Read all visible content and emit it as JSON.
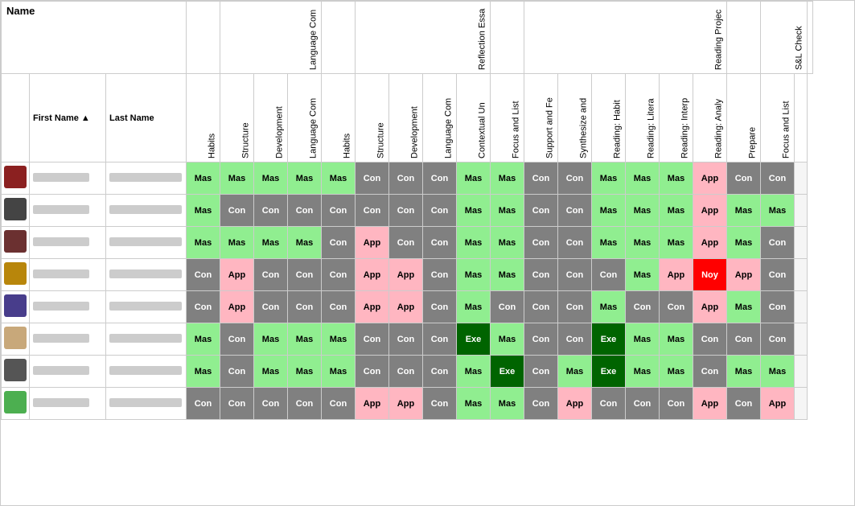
{
  "table": {
    "topHeaders": [
      {
        "label": "Name",
        "colspan": 3
      },
      {
        "label": "",
        "colspan": 1
      },
      {
        "label": "Language Com",
        "colspan": 3
      },
      {
        "label": "",
        "colspan": 1
      },
      {
        "label": "Reflection Essa",
        "colspan": 4
      },
      {
        "label": "",
        "colspan": 1
      },
      {
        "label": "Reading Projec",
        "colspan": 6
      },
      {
        "label": "",
        "colspan": 1
      },
      {
        "label": "S&L Check",
        "colspan": 3
      }
    ],
    "subHeaders": [
      "Habits",
      "Structure",
      "Development",
      "Language Com",
      "Habits",
      "Structure",
      "Development",
      "Language Com",
      "Contextual Un",
      "Focus and List",
      "Support and Fe",
      "Synthesize and",
      "Reading: Habit",
      "Reading: Litera",
      "Reading: Interp",
      "Reading: Analy",
      "Prepare",
      "Focus and List"
    ],
    "nameHeaders": [
      "First Name ▲",
      "Last Name"
    ],
    "avatarColors": [
      "#8B2020",
      "#444",
      "#6B3030",
      "#B8860B",
      "#483D8B",
      "#C8A87A",
      "#555",
      "#4CAF50"
    ],
    "rows": [
      {
        "cells": [
          "Mas",
          "Mas",
          "Mas",
          "Mas",
          "Mas",
          "Con",
          "Con",
          "Con",
          "Mas",
          "Mas",
          "Con",
          "Con",
          "Mas",
          "Mas",
          "Mas",
          "App",
          "Con",
          "Con"
        ]
      },
      {
        "cells": [
          "Mas",
          "Con",
          "Con",
          "Con",
          "Con",
          "Con",
          "Con",
          "Con",
          "Mas",
          "Mas",
          "Con",
          "Con",
          "Mas",
          "Mas",
          "Mas",
          "App",
          "Mas",
          "Mas"
        ]
      },
      {
        "cells": [
          "Mas",
          "Mas",
          "Mas",
          "Mas",
          "Con",
          "App",
          "Con",
          "Con",
          "Mas",
          "Mas",
          "Con",
          "Con",
          "Mas",
          "Mas",
          "Mas",
          "App",
          "Mas",
          "Con"
        ]
      },
      {
        "cells": [
          "Con",
          "App",
          "Con",
          "Con",
          "Con",
          "App",
          "App",
          "Con",
          "Mas",
          "Mas",
          "Con",
          "Con",
          "Con",
          "Mas",
          "App",
          "Noy",
          "App",
          "Con"
        ]
      },
      {
        "cells": [
          "Con",
          "App",
          "Con",
          "Con",
          "Con",
          "App",
          "App",
          "Con",
          "Mas",
          "Con",
          "Con",
          "Con",
          "Mas",
          "Con",
          "Con",
          "App",
          "Mas",
          "Con"
        ]
      },
      {
        "cells": [
          "Mas",
          "Con",
          "Mas",
          "Mas",
          "Mas",
          "Con",
          "Con",
          "Con",
          "Exe",
          "Mas",
          "Con",
          "Con",
          "Exe",
          "Mas",
          "Mas",
          "Con",
          "Con",
          "Con"
        ]
      },
      {
        "cells": [
          "Mas",
          "Con",
          "Mas",
          "Mas",
          "Mas",
          "Con",
          "Con",
          "Con",
          "Mas",
          "Exe",
          "Con",
          "Mas",
          "Exe",
          "Mas",
          "Mas",
          "Con",
          "Mas",
          "Mas"
        ]
      },
      {
        "cells": [
          "Con",
          "Con",
          "Con",
          "Con",
          "Con",
          "App",
          "App",
          "Con",
          "Mas",
          "Mas",
          "Con",
          "App",
          "Con",
          "Con",
          "Con",
          "App",
          "Con",
          "App"
        ]
      }
    ]
  }
}
